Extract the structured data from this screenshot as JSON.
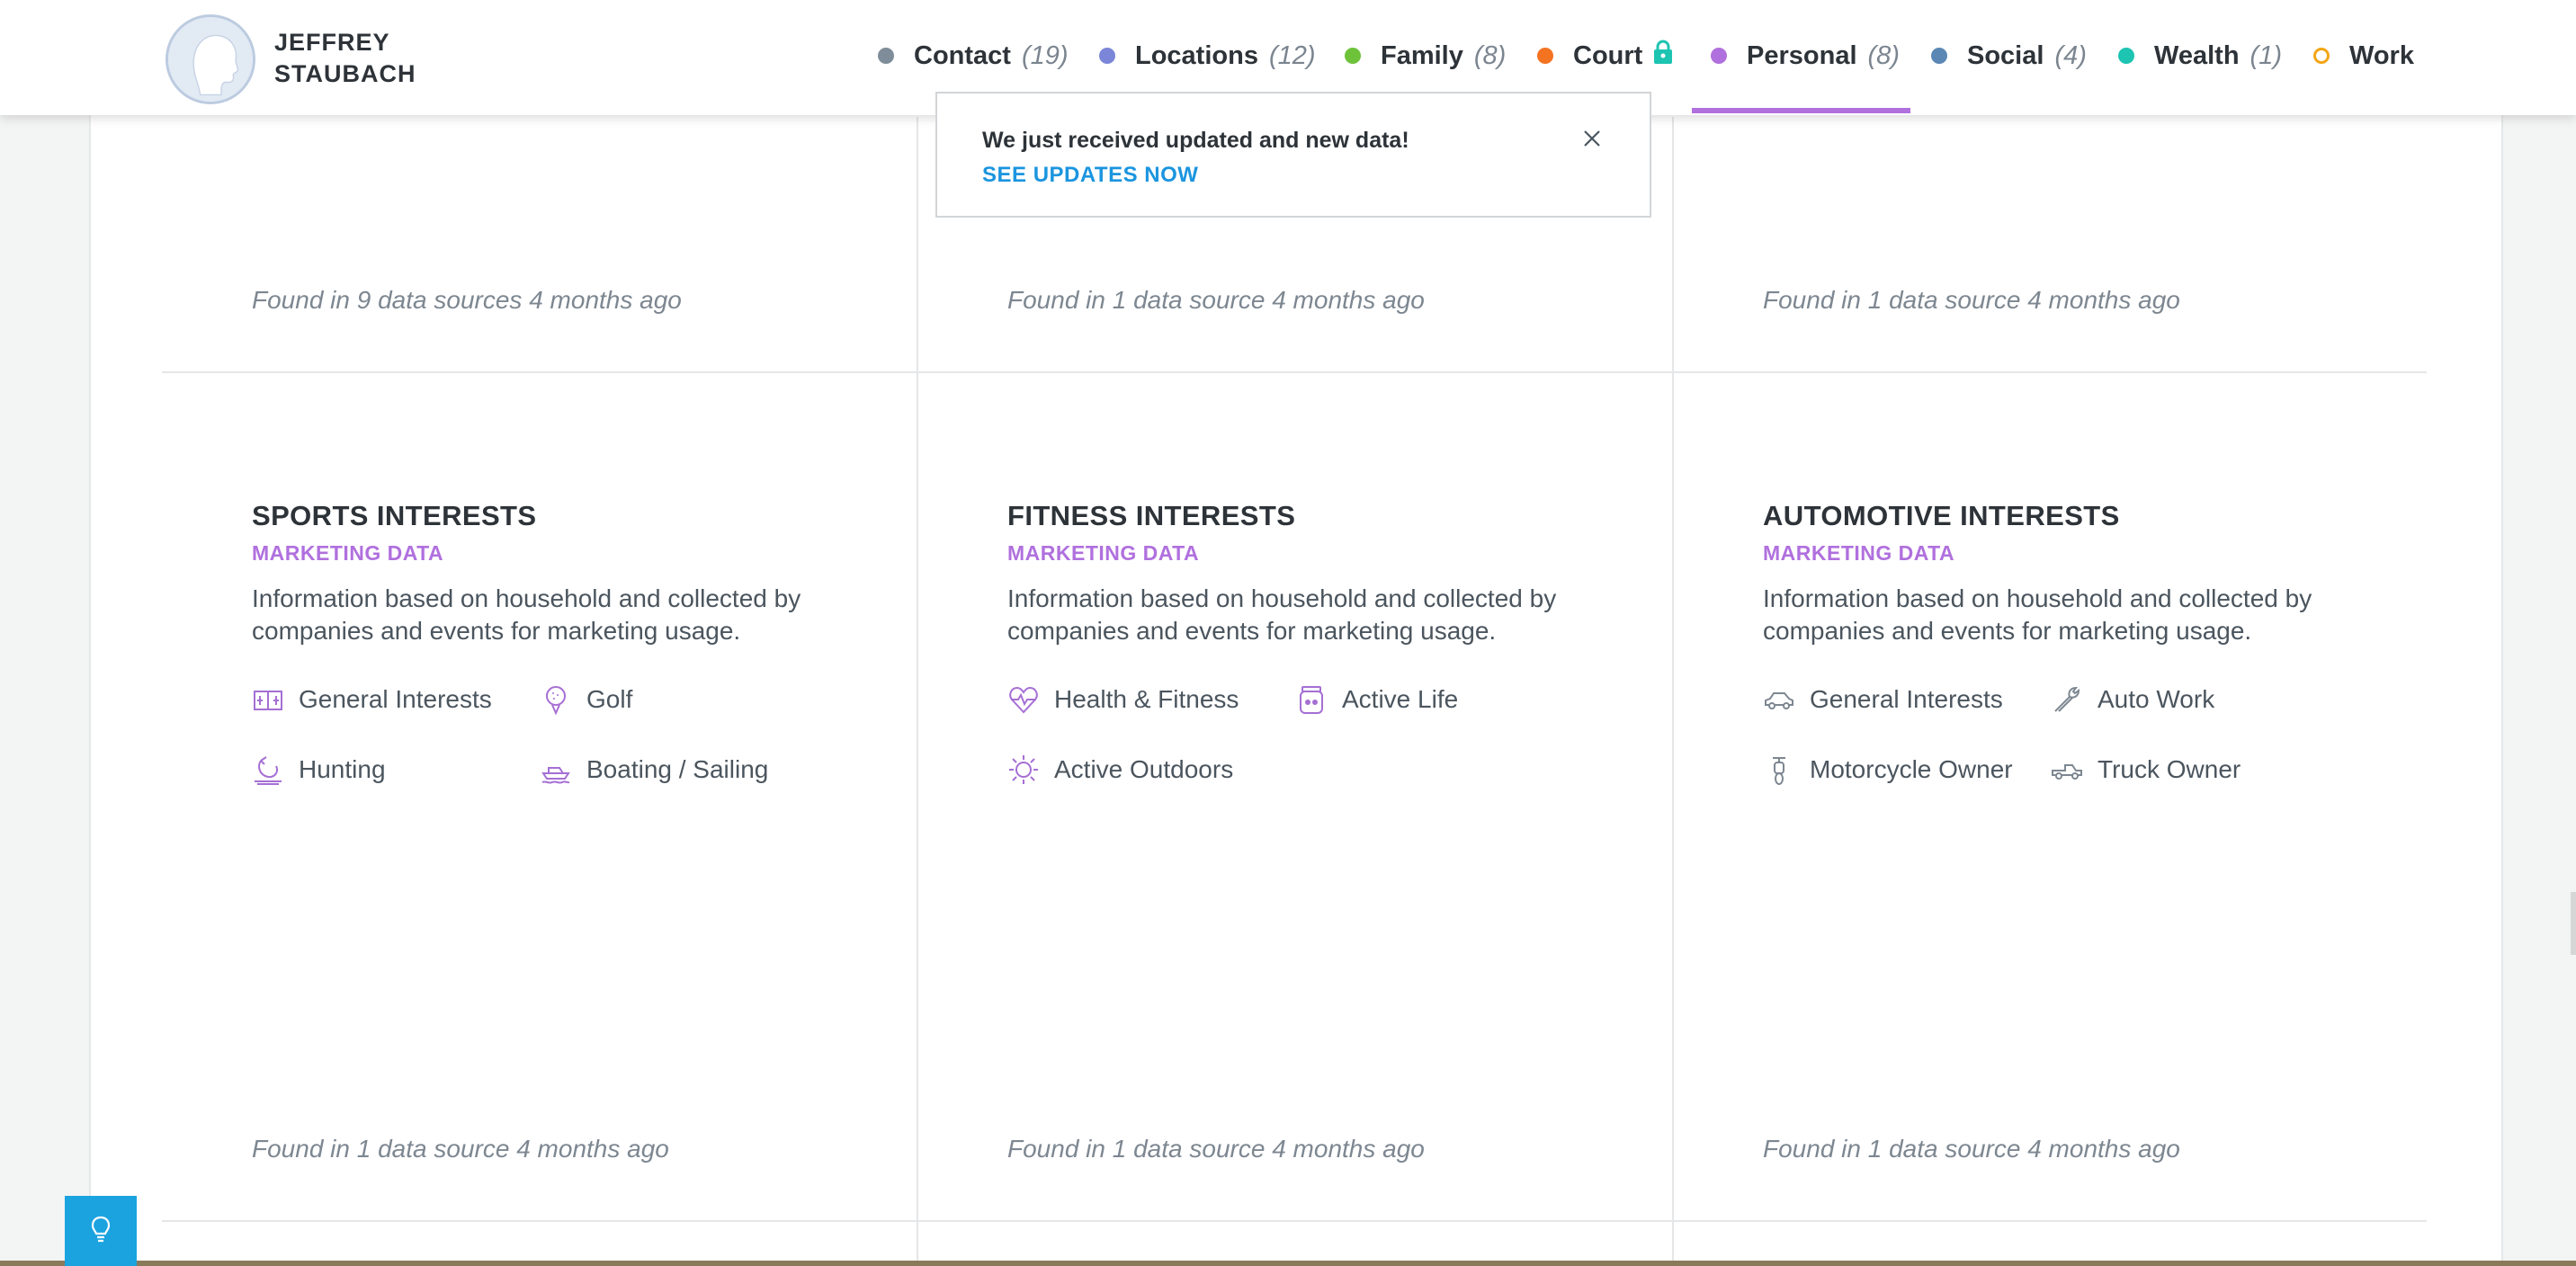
{
  "profile": {
    "first_name": "JEFFREY",
    "last_name": "STAUBACH"
  },
  "nav": {
    "items": [
      {
        "label": "Contact",
        "count": "(19)",
        "dot_color": "#7f8c99",
        "hollow": false
      },
      {
        "label": "Locations",
        "count": "(12)",
        "dot_color": "#7b86d8",
        "hollow": false
      },
      {
        "label": "Family",
        "count": "(8)",
        "dot_color": "#6dc23a",
        "hollow": false
      },
      {
        "label": "Court",
        "count": "",
        "dot_color": "#f47321",
        "hollow": false,
        "icon": "lock-icon"
      },
      {
        "label": "Personal",
        "count": "(8)",
        "dot_color": "#b070de",
        "hollow": false,
        "active": true
      },
      {
        "label": "Social",
        "count": "(4)",
        "dot_color": "#5b87b5",
        "hollow": false
      },
      {
        "label": "Wealth",
        "count": "(1)",
        "dot_color": "#1dc4b2",
        "hollow": false
      },
      {
        "label": "Work",
        "count": "",
        "dot_color": "#f2a516",
        "hollow": true
      }
    ]
  },
  "toast": {
    "message": "We just received updated and new data!",
    "link": "SEE UPDATES NOW"
  },
  "top_row": {
    "found": [
      "Found in 9 data sources 4 months ago",
      "Found in 1 data source 4 months ago",
      "Found in 1 data source 4 months ago"
    ]
  },
  "cards": [
    {
      "title": "SPORTS INTERESTS",
      "subtitle": "MARKETING DATA",
      "description": "Information based on household and collected by companies and events for marketing usage.",
      "tags": [
        {
          "label": "General Interests",
          "icon": "scoreboard-icon"
        },
        {
          "label": "Golf",
          "icon": "golf-ball-icon"
        },
        {
          "label": "Hunting",
          "icon": "hunting-icon"
        },
        {
          "label": "Boating / Sailing",
          "icon": "boat-icon"
        }
      ],
      "found": "Found in 1 data source 4 months ago"
    },
    {
      "title": "FITNESS INTERESTS",
      "subtitle": "MARKETING DATA",
      "description": "Information based on household and collected by companies and events for marketing usage.",
      "tags": [
        {
          "label": "Health & Fitness",
          "icon": "heart-pulse-icon"
        },
        {
          "label": "Active Life",
          "icon": "jar-icon"
        },
        {
          "label": "Active Outdoors",
          "icon": "sun-icon"
        }
      ],
      "found": "Found in 1 data source 4 months ago"
    },
    {
      "title": "AUTOMOTIVE INTERESTS",
      "subtitle": "MARKETING DATA",
      "description": "Information based on household and collected by companies and events for marketing usage.",
      "tags": [
        {
          "label": "General Interests",
          "icon": "car-icon"
        },
        {
          "label": "Auto Work",
          "icon": "wrench-icon"
        },
        {
          "label": "Motorcycle Owner",
          "icon": "motorcycle-icon"
        },
        {
          "label": "Truck Owner",
          "icon": "truck-icon"
        }
      ],
      "found": "Found in 1 data source 4 months ago"
    }
  ],
  "colors": {
    "accent": "#b070de",
    "link": "#1b95df",
    "help_button": "#1ba3e0"
  },
  "help_button_icon": "lightbulb-icon"
}
